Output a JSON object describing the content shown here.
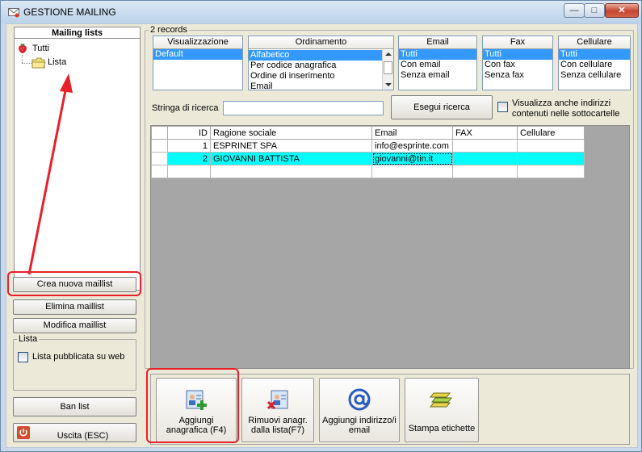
{
  "window": {
    "title": "GESTIONE MAILING",
    "controls": {
      "minimize": "—",
      "maximize": "□",
      "close": "✕"
    }
  },
  "left": {
    "header": "Mailing lists",
    "tree": [
      {
        "label": "Tutti",
        "icon": "strawberry-icon"
      },
      {
        "label": "Lista",
        "icon": "folder-icon"
      }
    ],
    "buttons": {
      "create": "Crea nuova maillist",
      "delete": "Elimina maillist",
      "edit": "Modifica maillist",
      "ban": "Ban list",
      "exit": "Uscita (ESC)"
    },
    "group": {
      "legend": "Lista",
      "checkbox_label": "Lista pubblicata su web",
      "checked": false
    }
  },
  "right": {
    "records_label": "2 records",
    "filters": [
      {
        "header": "Visualizzazione",
        "items": [
          "Default"
        ],
        "selected": 0
      },
      {
        "header": "Ordinamento",
        "items": [
          "Alfabetico",
          "Per codice anagrafica",
          "Ordine di inserimento",
          "Email"
        ],
        "selected": 0
      },
      {
        "header": "Email",
        "items": [
          "Tutti",
          "Con email",
          "Senza email"
        ],
        "selected": 0
      },
      {
        "header": "Fax",
        "items": [
          "Tutti",
          "Con fax",
          "Senza fax"
        ],
        "selected": 0
      },
      {
        "header": "Cellulare",
        "items": [
          "Tutti",
          "Con cellulare",
          "Senza cellulare"
        ],
        "selected": 0
      }
    ],
    "search": {
      "label": "Stringa di ricerca",
      "value": "",
      "button": "Esegui ricerca",
      "subfolder_checkbox": "Visualizza anche indirizzi contenuti nelle sottocartelle",
      "subfolder_checked": false
    },
    "grid": {
      "columns": [
        "ID",
        "Ragione sociale",
        "Email",
        "FAX",
        "Cellulare"
      ],
      "rows": [
        {
          "id": "1",
          "name": "ESPRINET SPA",
          "email": "info@esprinte.com",
          "fax": "",
          "cell": ""
        },
        {
          "id": "2",
          "name": "GIOVANNI BATTISTA",
          "email": "giovanni@tin.it",
          "fax": "",
          "cell": ""
        }
      ],
      "selected_row": 1
    },
    "toolbar": [
      {
        "label": "Aggiungi anagrafica (F4)",
        "icon": "add-contact-icon"
      },
      {
        "label": "Rimuovi anagr. dalla lista(F7)",
        "icon": "remove-contact-icon"
      },
      {
        "label": "Aggiungi indirizzo/i email",
        "icon": "at-sign-icon"
      },
      {
        "label": "Stampa etichette",
        "icon": "labels-stack-icon"
      }
    ]
  },
  "colors": {
    "selection": "#3399ff",
    "row_highlight": "#00ffff",
    "annotation": "#e8202a"
  }
}
